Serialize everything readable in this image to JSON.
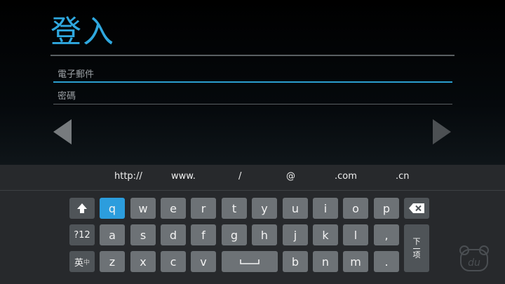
{
  "page": {
    "title": "登入",
    "email_placeholder": "電子郵件",
    "password_placeholder": "密碼"
  },
  "suggestions": [
    "http://",
    "www.",
    "/",
    "@",
    ".com",
    ".cn"
  ],
  "keyboard": {
    "row1": [
      "q",
      "w",
      "e",
      "r",
      "t",
      "y",
      "u",
      "i",
      "o",
      "p"
    ],
    "row2": [
      "a",
      "s",
      "d",
      "f",
      "g",
      "h",
      "j",
      "k",
      "l",
      ","
    ],
    "row3": [
      "z",
      "x",
      "c",
      "v",
      "b",
      "n",
      "m",
      "."
    ],
    "symbols_label": "?12",
    "lang_label_main": "英",
    "lang_label_sub": "中",
    "next_label_top": "下",
    "next_label_bottom": "项",
    "highlighted_key": "q"
  },
  "colors": {
    "accent": "#2fa8df",
    "key": "#6d7276",
    "key_highlight": "#2c9ddd",
    "keyboard_bg": "#27292c"
  },
  "icons": {
    "prev": "triangle-left-icon",
    "next": "triangle-right-icon",
    "shift": "shift-arrow-icon",
    "backspace": "backspace-icon",
    "space": "space-bar-icon",
    "watermark": "bear-du-logo-icon"
  }
}
